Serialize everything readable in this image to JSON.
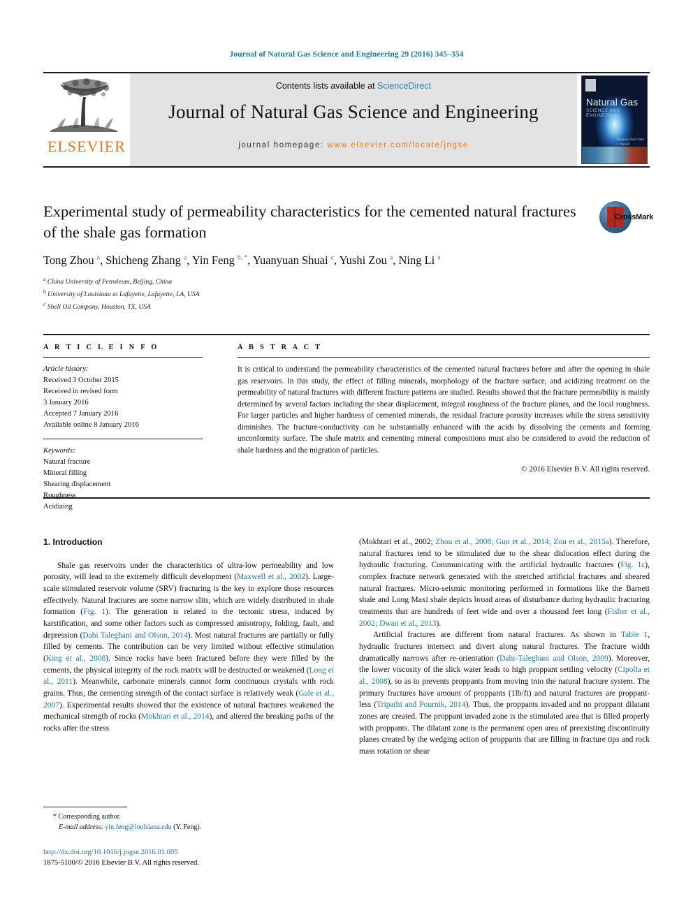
{
  "running_head": "Journal of Natural Gas Science and Engineering 29 (2016) 345–354",
  "masthead": {
    "contents_prefix": "Contents lists available at ",
    "sciencedirect": "ScienceDirect",
    "journal_title": "Journal of Natural Gas Science and Engineering",
    "homepage_prefix": "journal homepage: ",
    "homepage_url": "www.elsevier.com/locate/jngse",
    "elsevier_wordmark": "ELSEVIER",
    "elsevier_color": "#e8761a",
    "sciencedirect_color": "#2a7fb8",
    "cover": {
      "title": "Natural Gas",
      "subtitle": "SCIENCE AND ENGINEERING",
      "editors": "Editor-in-Chief\nJohn J. Carroll"
    }
  },
  "article": {
    "title": "Experimental study of permeability characteristics for the cemented natural fractures of the shale gas formation",
    "authors_html": "Tong Zhou <sup>a</sup>, Shicheng Zhang <sup>a</sup>, Yin Feng <sup>b, *</sup>, Yuanyuan Shuai <sup>c</sup>, Yushi Zou <sup>a</sup>, Ning Li <sup>a</sup>",
    "affiliations": [
      {
        "marker": "a",
        "text": "China University of Petroleum, Beijing, China"
      },
      {
        "marker": "b",
        "text": "University of Louisiana at Lafayette, Lafayette, LA, USA"
      },
      {
        "marker": "c",
        "text": "Shell Oil Company, Houston, TX, USA"
      }
    ],
    "crossmark_label": "CrossMark"
  },
  "article_info": {
    "heading": "A R T I C L E   I N F O",
    "history_label": "Article history:",
    "history": [
      "Received 3 October 2015",
      "Received in revised form",
      "3 January 2016",
      "Accepted 7 January 2016",
      "Available online 8 January 2016"
    ],
    "keywords_label": "Keywords:",
    "keywords": [
      "Natural fracture",
      "Mineral filling",
      "Shearing displacement",
      "Roughness",
      "Acidizing"
    ]
  },
  "abstract": {
    "heading": "A B S T R A C T",
    "text": "It is critical to understand the permeability characteristics of the cemented natural fractures before and after the opening in shale gas reservoirs. In this study, the effect of filling minerals, morphology of the fracture surface, and acidizing treatment on the permeability of natural fractures with different fracture patterns are studied. Results showed that the fracture permeability is mainly determined by several factors including the shear displacement, integral roughness of the fracture planes, and the local roughness. For larger particles and higher hardness of cemented minerals, the residual fracture porosity increases while the stress sensitivity diminishes. The fracture-conductivity can be substantially enhanced with the acids by dissolving the cements and forming unconformity surface. The shale matrix and cementing mineral compositions must also be considered to avoid the reduction of shale hardness and the migration of particles.",
    "copyright": "© 2016 Elsevier B.V. All rights reserved."
  },
  "body": {
    "section_number_title": "1. Introduction",
    "left_column_html": "<p class=\"para\">Shale gas reservoirs under the characteristics of ultra-low permeability and low porosity, will lead to the extremely difficult development (<span class=\"ref\">Maxwell et al., 2002</span>). Large-scale stimulated reservoir volume (SRV) fracturing is the key to explore those resources effectively. Natural fractures are some narrow slits, which are widely distributed in shale formation (<span class=\"ref\">Fig. 1</span>). The generation is related to the tectonic stress, induced by karstification, and some other factors such as compressed anisotropy, folding, fault, and depression (<span class=\"ref\">Dahi Taleghani and Olson, 2014</span>). Most natural fractures are partially or fully filled by cements. The contribution can be very limited without effective stimulation (<span class=\"ref\">King et al., 2008</span>). Since rocks have been fractured before they were filled by the cements, the physical integrity of the rock matrix will be destructed or weakened (<span class=\"ref\">Long et al., 2011</span>). Meanwhile, carbonate minerals cannot form continuous crystals with rock grains. Thus, the cementing strength of the contact surface is relatively weak (<span class=\"ref\">Gale et al., 2007</span>). Experimental results showed that the existence of natural fractures weakened the mechanical strength of rocks (<span class=\"ref\">Mokhtari et al., 2014</span>), and altered the breaking paths of the rocks after the stress</p>",
    "right_column_html": "<p class=\"para\" style=\"text-indent:0\">(Mokhtari et al., 2002; <span class=\"ref\">Zhou et al., 2008; Guo et al., 2014; Zou et al., 2015a</span>). Therefore, natural fractures tend to be stimulated due to the shear dislocation effect during the hydraulic fracturing. Communicating with the artificial hydraulic fractures (<span class=\"ref\">Fig. 1c</span>), complex fracture network generated with the stretched artificial fractures and sheared natural fractures. Micro-seismic monitoring performed in formations like the Barnett shale and Long Maxi shale depicts broad areas of disturbance during hydraulic fracturing treatments that are hundreds of feet wide and over a thousand feet long (<span class=\"ref\">Fisher et al., 2002; Dwan et al., 2013</span>).</p><p class=\"para\">Artificial fractures are different from natural fractures. As shown in <span class=\"ref\">Table 1</span>, hydraulic fractures intersect and divert along natural fractures. The fracture width dramatically narrows after re-orientation (<span class=\"ref\">Dahi-Taleghani and Olson, 2009</span>). Moreover, the lower viscosity of the slick water leads to high proppant settling velocity (<span class=\"ref\">Cipolla et al., 2008</span>), so as to prevents proppants from moving into the natural fracture system. The primary fractures have amount of proppants (1lb/ft) and natural fractures are proppant-less (<span class=\"ref\">Tripathi and Pournik, 2014</span>). Thus, the proppants invaded and no proppant dilatant zones are created. The proppant invaded zone is the stimulated area that is filled properly with proppants. The dilatant zone is the permanent open area of preexisting discontinuity planes created by the wedging action of proppants that are filling in fracture tips and rock mass rotation or shear</p>"
  },
  "footnote": {
    "corresponding_marker": "*",
    "corresponding_text": "Corresponding author.",
    "email_label": "E-mail address:",
    "email": "yin.feng@louisiana.edu",
    "email_owner": "(Y. Feng)."
  },
  "doi": {
    "url": "http://dx.doi.org/10.1016/j.jngse.2016.01.005",
    "copyright_line": "1875-5100/© 2016 Elsevier B.V. All rights reserved."
  }
}
